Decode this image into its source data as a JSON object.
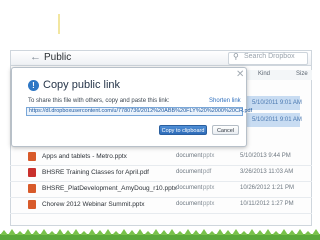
{
  "window": {
    "folder_title": "Public",
    "search_placeholder": "Search Dropbox"
  },
  "columns": {
    "kind": "Kind",
    "size": "Size"
  },
  "background_dates": {
    "row1": "5/10/2011 9:01 AM",
    "row2": "5/10/2011 9:01 AM"
  },
  "dialog": {
    "title": "Copy public link",
    "instruction": "To share this file with others, copy and paste this link:",
    "shorten_link": "Shorten link",
    "link_value": "https://dl.dropboxusercontent.com/u/7780736/2012%20ABB%20FLY%20%2000%20CR.pdf",
    "copy_button": "Copy to clipboard",
    "cancel_button": "Cancel"
  },
  "files": [
    {
      "name": "Apps and tablets - Metro.pptx",
      "kind": "document",
      "ext": "pptx",
      "date": "5/10/2013 9:44 PM",
      "icon_color": "#d85a2a"
    },
    {
      "name": "BHSRE Training Classes for April.pdf",
      "kind": "document",
      "ext": "pdf",
      "date": "3/26/2013 11:03 AM",
      "icon_color": "#c9302c"
    },
    {
      "name": "BHSRE_PlatDevelopment_AmyDoug_r10.pptx",
      "kind": "document",
      "ext": "pptx",
      "date": "10/26/2012 1:21 PM",
      "icon_color": "#d85a2a"
    },
    {
      "name": "Chorew 2012 Webinar Summit.pptx",
      "kind": "document",
      "ext": "pptx",
      "date": "10/11/2012 1:27 PM",
      "icon_color": "#d85a2a"
    }
  ],
  "colors": {
    "accent": "#2e77c5",
    "grass": "#5aa83a"
  }
}
